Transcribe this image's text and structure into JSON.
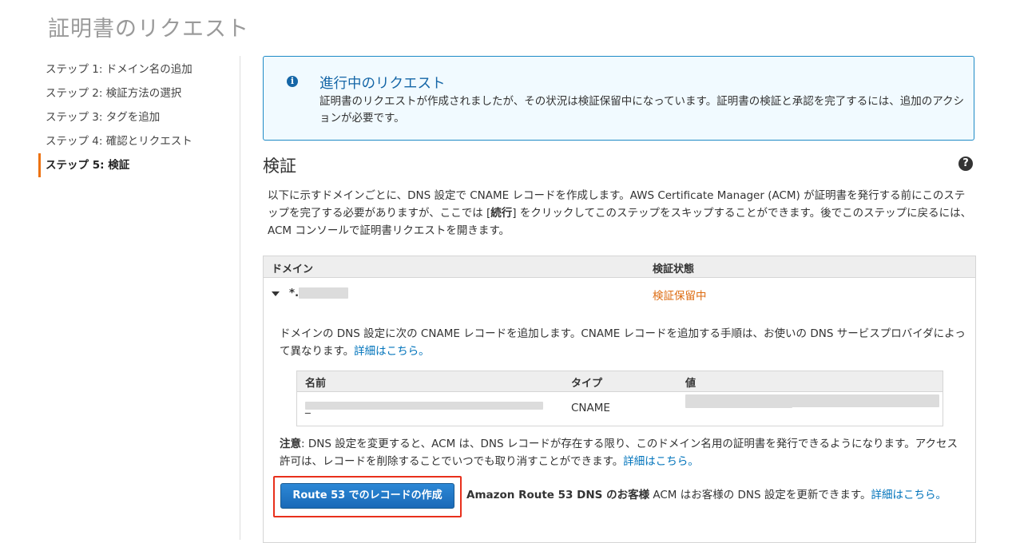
{
  "page": {
    "title": "証明書のリクエスト"
  },
  "steps": [
    {
      "label": "ステップ 1: ドメイン名の追加"
    },
    {
      "label": "ステップ 2: 検証方法の選択"
    },
    {
      "label": "ステップ 3: タグを追加"
    },
    {
      "label": "ステップ 4: 確認とリクエスト"
    },
    {
      "label": "ステップ 5: 検証",
      "active": true
    }
  ],
  "alert": {
    "icon": "info-icon",
    "title": "進行中のリクエスト",
    "body": "証明書のリクエストが作成されましたが、その状況は検証保留中になっています。証明書の検証と承認を完了するには、追加のアクションが必要です。"
  },
  "verification": {
    "title": "検証",
    "help_icon": "question-circle-icon",
    "intro_1": "以下に示すドメインごとに、DNS 設定で CNAME レコードを作成します。AWS Certificate Manager (ACM) が証明書を発行する前にこのステップを完了する必要がありますが、ここでは [",
    "intro_bold": "続行",
    "intro_2": "] をクリックしてこのステップをスキップすることができます。後でこのステップに戻るには、ACM コンソールで証明書リクエストを開きます。",
    "table": {
      "col_domain": "ドメイン",
      "col_status": "検証状態",
      "domain_prefix": "*.",
      "status": "検証保留中",
      "status_color": "#dd6b10",
      "instructions": "ドメインの DNS 設定に次の CNAME レコードを追加します。CNAME レコードを追加する手順は、お使いの DNS サービスプロバイダによって異なります。",
      "instructions_link": "詳細はこちら。",
      "records": {
        "col_name": "名前",
        "col_type": "タイプ",
        "col_value": "値",
        "name_prefix": "_",
        "type": "CNAME"
      },
      "note_bold": "注意",
      "note_text": ": DNS 設定を変更すると、ACM は、DNS レコードが存在する限り、このドメイン名用の証明書を発行できるようになります。アクセス許可は、レコードを削除することでいつでも取り消すことができます。",
      "note_link": "詳細はこちら。",
      "route53_button": "Route 53 でのレコードの作成",
      "route53_bold": "Amazon Route 53 DNS のお客様",
      "route53_text": " ACM はお客様の DNS 設定を更新できます。",
      "route53_link": "詳細はこちら。"
    }
  },
  "colors": {
    "accent": "#ec7211",
    "link": "#0073bb",
    "info": "#1566a7",
    "highlight": "#e8301c"
  }
}
